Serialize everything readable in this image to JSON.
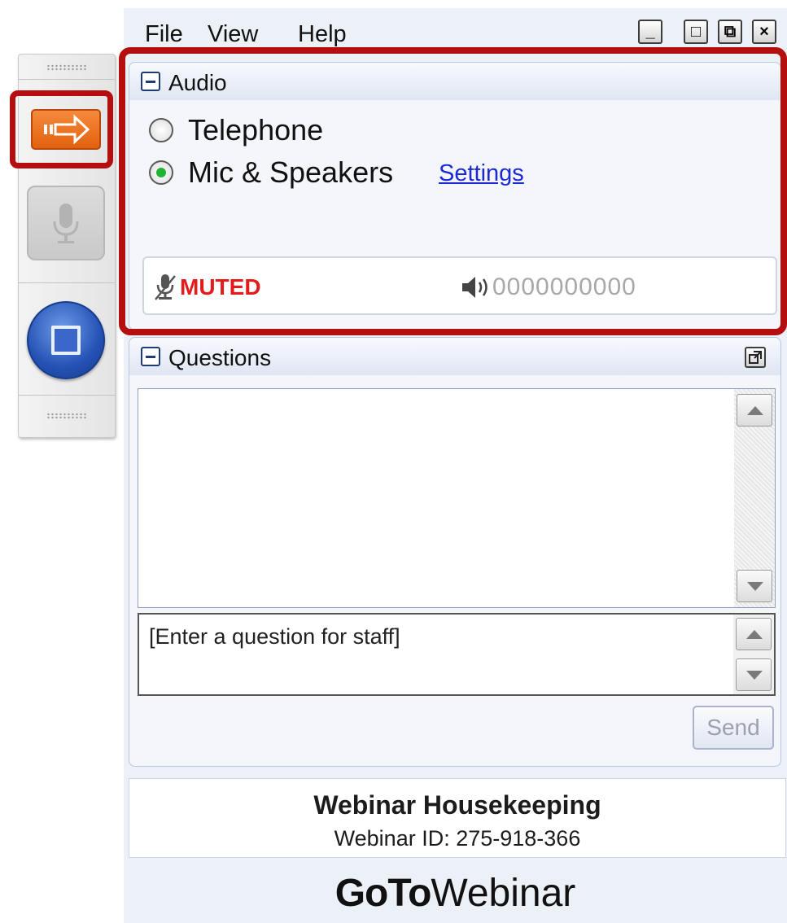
{
  "menu": {
    "file": "File",
    "view": "View",
    "help": "Help"
  },
  "window_controls": {
    "minimize": "_",
    "maximize": "□",
    "restore": "⧉",
    "close": "×"
  },
  "audio": {
    "title": "Audio",
    "options": [
      {
        "label": "Telephone",
        "selected": false
      },
      {
        "label": "Mic & Speakers",
        "selected": true
      }
    ],
    "settings_link": "Settings",
    "mic_status": "MUTED",
    "speaker_level": "0000000000"
  },
  "questions": {
    "title": "Questions",
    "input_placeholder": "[Enter a question for staff]",
    "send_label": "Send"
  },
  "info": {
    "title": "Webinar Housekeeping",
    "webinar_id": "Webinar ID: 275-918-366"
  },
  "brand": {
    "bold": "GoTo",
    "regular": "Webinar"
  },
  "colors": {
    "muted": "#e31b1b",
    "highlight": "#b40e0e",
    "link": "#1a2bd6",
    "orange": "#e2620f"
  },
  "icons": [
    "show-panel-arrow-icon",
    "microphone-icon",
    "stop-screen-icon",
    "speaker-icon",
    "popout-icon"
  ]
}
